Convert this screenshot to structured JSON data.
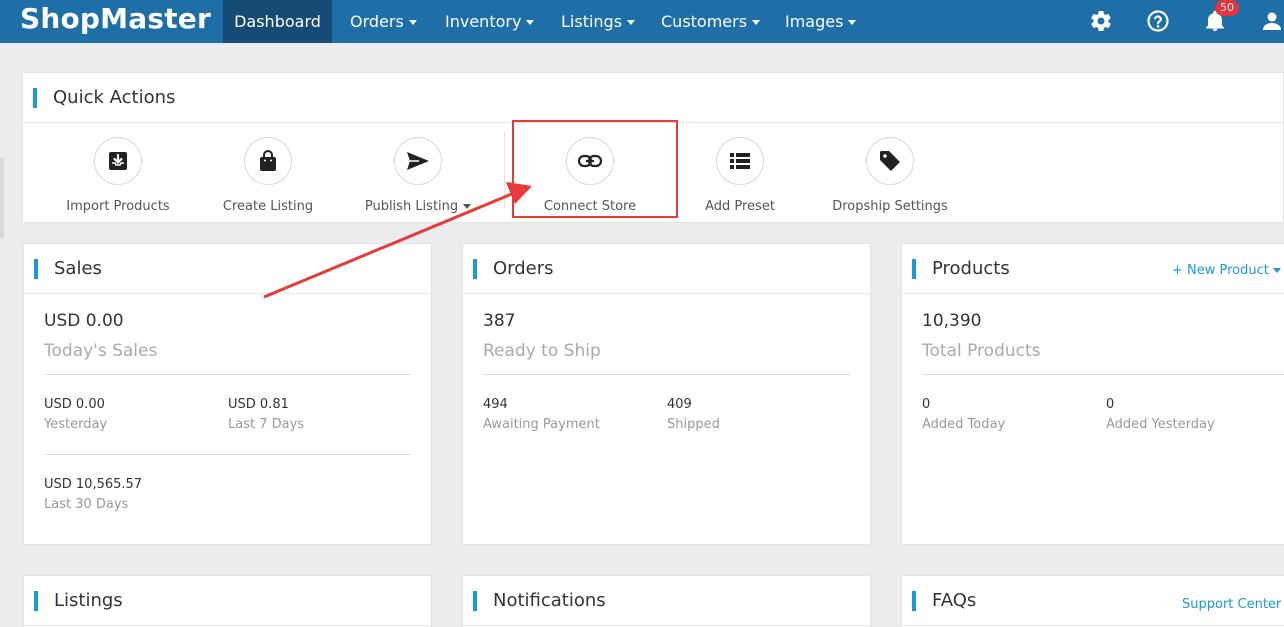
{
  "brand": "ShopMaster",
  "nav": [
    {
      "label": "Dashboard",
      "active": true,
      "dropdown": false
    },
    {
      "label": "Orders",
      "active": false,
      "dropdown": true
    },
    {
      "label": "Inventory",
      "active": false,
      "dropdown": true
    },
    {
      "label": "Listings",
      "active": false,
      "dropdown": true
    },
    {
      "label": "Customers",
      "active": false,
      "dropdown": true
    },
    {
      "label": "Images",
      "active": false,
      "dropdown": true
    }
  ],
  "top_icons": [
    "gear-icon",
    "help-icon",
    "bell-icon",
    "user-icon"
  ],
  "notifications_count": "50",
  "quick_actions": {
    "title": "Quick Actions",
    "items": [
      {
        "label": "Import Products",
        "icon": "import-icon"
      },
      {
        "label": "Create Listing",
        "icon": "shopping-bag-icon"
      },
      {
        "label": "Publish Listing",
        "icon": "send-icon",
        "dropdown": true
      },
      {
        "label": "Connect Store",
        "icon": "link-icon",
        "highlighted": true
      },
      {
        "label": "Add Preset",
        "icon": "list-icon"
      },
      {
        "label": "Dropship Settings",
        "icon": "tag-icon"
      }
    ]
  },
  "sales": {
    "title": "Sales",
    "main_value": "USD 0.00",
    "main_label": "Today's Sales",
    "stats": [
      {
        "value": "USD 0.00",
        "label": "Yesterday"
      },
      {
        "value": "USD 0.81",
        "label": "Last 7 Days"
      },
      {
        "value": "USD 10,565.57",
        "label": "Last 30 Days"
      }
    ]
  },
  "orders": {
    "title": "Orders",
    "main_value": "387",
    "main_label": "Ready to Ship",
    "stats": [
      {
        "value": "494",
        "label": "Awaiting Payment"
      },
      {
        "value": "409",
        "label": "Shipped"
      }
    ]
  },
  "products": {
    "title": "Products",
    "action": "+ New Product",
    "main_value": "10,390",
    "main_label": "Total Products",
    "stats": [
      {
        "value": "0",
        "label": "Added Today"
      },
      {
        "value": "0",
        "label": "Added Yesterday"
      }
    ]
  },
  "listings": {
    "title": "Listings"
  },
  "notifications": {
    "title": "Notifications"
  },
  "faqs": {
    "title": "FAQs",
    "action": "Support Center"
  },
  "colors": {
    "nav_bg": "#1e6fa8",
    "nav_active": "#154b75",
    "accent": "#1a9ad6",
    "highlight": "#e83a37",
    "badge": "#e8333a"
  }
}
